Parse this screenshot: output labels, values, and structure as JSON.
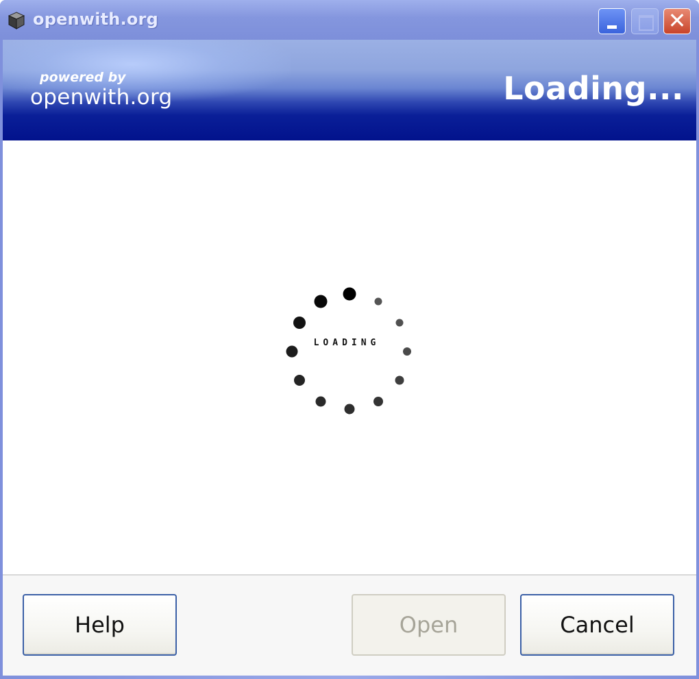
{
  "window": {
    "title": "openwith.org",
    "icon": "package-icon",
    "controls": [
      "minimize-icon",
      "maximize-icon",
      "close-icon"
    ],
    "close_glyph": "✕"
  },
  "banner": {
    "powered_by": "powered by",
    "brand": "openwith.org",
    "heading": "Loading..."
  },
  "spinner": {
    "label": "LOADING",
    "dot_count": 12
  },
  "buttons": {
    "help": "Help",
    "open": "Open",
    "cancel": "Cancel",
    "open_enabled": false
  },
  "colors": {
    "titlebar": "#7d8fda",
    "banner_dark": "#02128c",
    "close_button": "#c8432a",
    "button_border": "#3a5fa6"
  }
}
